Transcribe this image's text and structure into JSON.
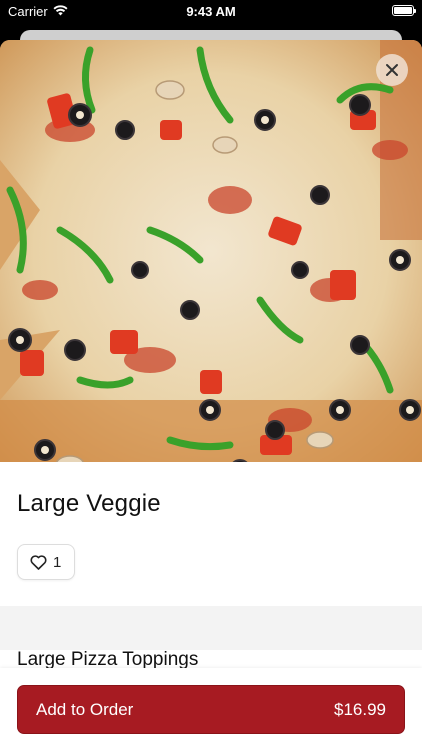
{
  "status_bar": {
    "carrier": "Carrier",
    "time": "9:43 AM"
  },
  "product": {
    "image": "pizza-photo",
    "name": "Large Veggie",
    "likes": "1"
  },
  "sections": [
    {
      "title": "Large Pizza Toppings"
    }
  ],
  "footer": {
    "add_label": "Add to Order",
    "price": "$16.99"
  },
  "colors": {
    "accent": "#a71b22",
    "background": "#ffffff",
    "section_band": "#f3f3f3"
  },
  "icons": {
    "close": "close-icon",
    "like": "heart-icon",
    "wifi": "wifi-icon",
    "battery": "battery-icon"
  }
}
